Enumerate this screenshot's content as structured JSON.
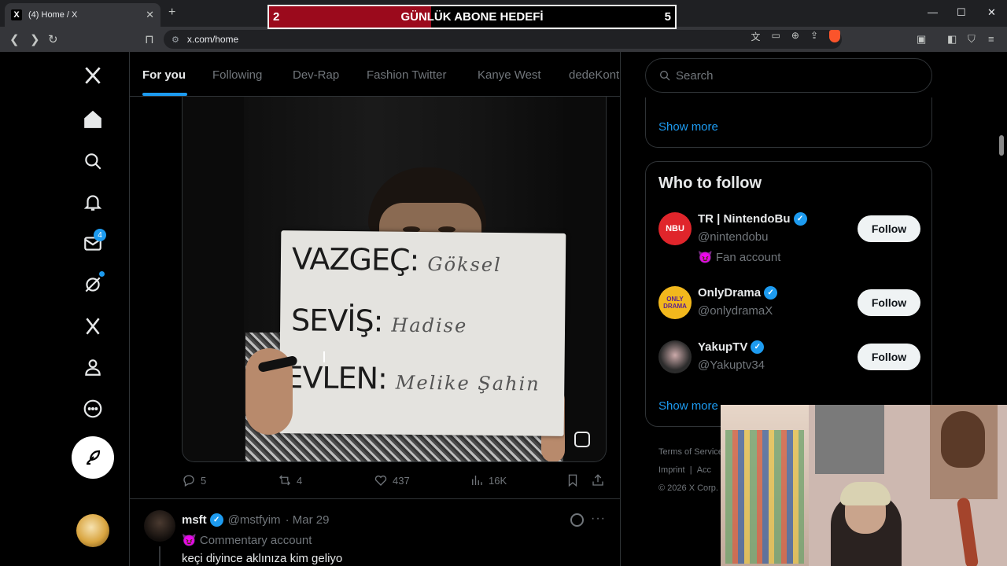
{
  "browser": {
    "tab_title": "(4) Home / X",
    "url": "x.com/home"
  },
  "goal_widget": {
    "left_number": "2",
    "label": "GÜNLÜK ABONE HEDEFİ",
    "right_number": "5",
    "progress_fraction": 0.4,
    "fill_color": "#9b0a1c"
  },
  "nav": {
    "messages_badge": "4",
    "icons": [
      "x-logo-icon",
      "home-icon",
      "search-icon",
      "bell-icon",
      "mail-icon",
      "grok-icon",
      "x-premium-icon",
      "profile-icon",
      "more-icon"
    ]
  },
  "feed_tabs": [
    "For you",
    "Following",
    "Dev-Rap",
    "Fashion Twitter",
    "Kanye West",
    "dedeKont"
  ],
  "post1": {
    "sign_lines": [
      {
        "label": "VAZGEÇ:",
        "handwriting": "Göksel"
      },
      {
        "label": "SEVİŞ:",
        "handwriting": "Hadise"
      },
      {
        "label": "EVLEN:",
        "handwriting": "Melike Şahin"
      }
    ],
    "replies": "5",
    "reposts": "4",
    "likes": "437",
    "views": "16K"
  },
  "post2": {
    "name": "msft",
    "handle": "@mstfyim",
    "date": "· Mar 29",
    "label": "Commentary account",
    "text": "keçi diyince aklınıza kim geliyo"
  },
  "sidebar": {
    "search_placeholder": "Search",
    "show_more": "Show more",
    "who_title": "Who to follow",
    "follow_label": "Follow",
    "accounts": [
      {
        "name": "TR | NintendoBu",
        "handle": "@nintendobu",
        "extra": "Fan account",
        "avatar_text": "NBU",
        "avatar_color": "#e0252b"
      },
      {
        "name": "OnlyDrama",
        "handle": "@onlydramaX",
        "extra": "",
        "avatar_text": "ONLY DRAMA",
        "avatar_color": "#f2b81d"
      },
      {
        "name": "YakupTV",
        "handle": "@Yakuptv34",
        "extra": "",
        "avatar_text": "",
        "avatar_color": "#2c2c2c"
      }
    ],
    "footer": [
      "Terms of Service",
      "Imprint",
      "Acc",
      "© 2026 X Corp."
    ]
  }
}
